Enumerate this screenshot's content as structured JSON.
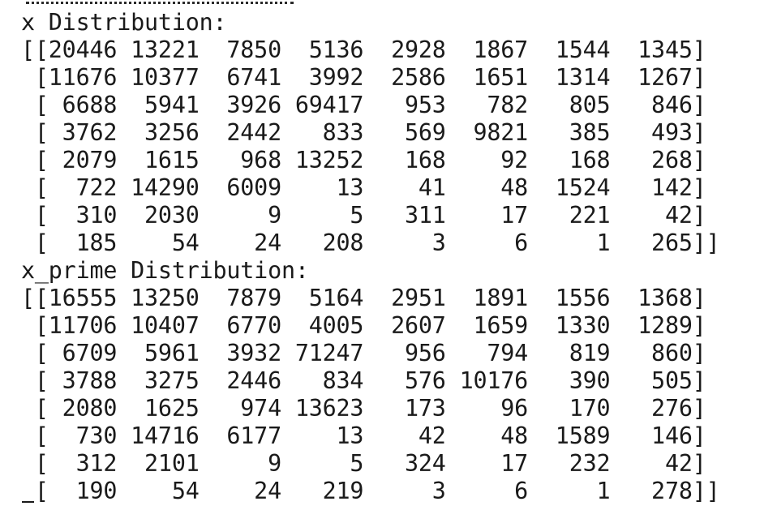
{
  "output": {
    "x_header": "x Distribution:",
    "x_rows": [
      "[[20446 13221  7850  5136  2928  1867  1544  1345]",
      " [11676 10377  6741  3992  2586  1651  1314  1267]",
      " [ 6688  5941  3926 69417   953   782   805   846]",
      " [ 3762  3256  2442   833   569  9821   385   493]",
      " [ 2079  1615   968 13252   168    92   168   268]",
      " [  722 14290  6009    13    41    48  1524   142]",
      " [  310  2030     9     5   311    17   221    42]",
      " [  185    54    24   208     3     6     1   265]]"
    ],
    "x_prime_header": "x_prime Distribution:",
    "x_prime_rows": [
      "[[16555 13250  7879  5164  2951  1891  1556  1368]",
      " [11706 10407  6770  4005  2607  1659  1330  1289]",
      " [ 6709  5961  3932 71247   956   794   819   860]",
      " [ 3788  3275  2446   834   576 10176   390   505]",
      " [ 2080  1625   974 13623   173    96   170   276]",
      " [  730 14716  6177    13    42    48  1589   146]",
      " [  312  2101     9     5   324    17   232    42]",
      " [  190    54    24   219     3     6     1   278]]"
    ]
  }
}
